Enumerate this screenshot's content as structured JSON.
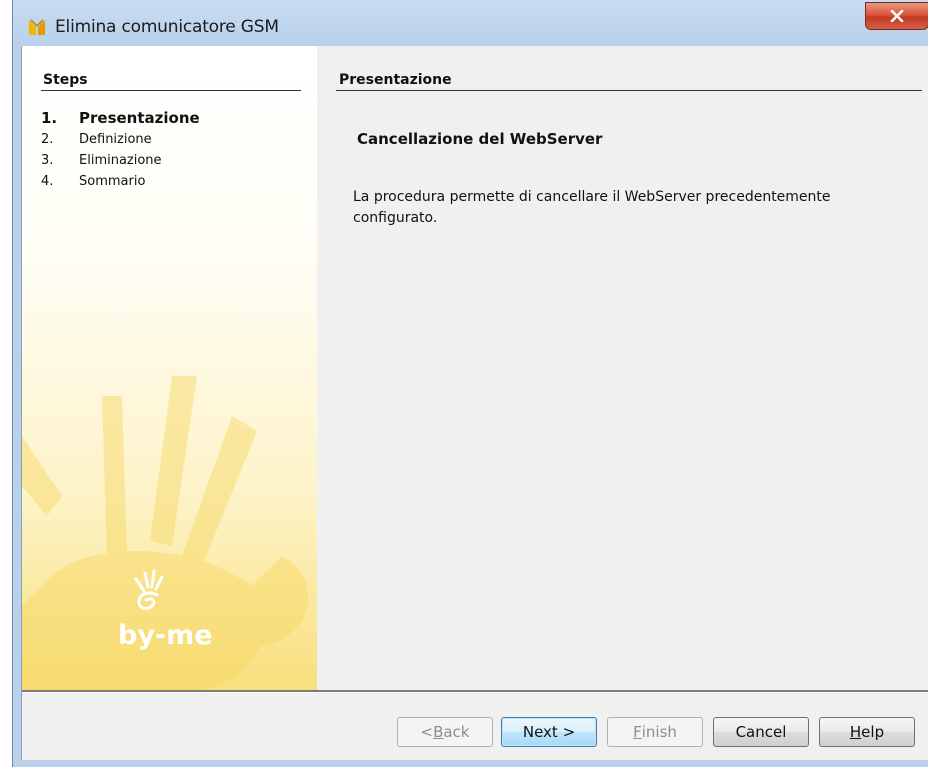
{
  "window": {
    "title": "Elimina comunicatore GSM",
    "accent": "#b9d1ec",
    "close_color": "#c23a1f"
  },
  "steps": {
    "title": "Steps",
    "items": [
      {
        "num": "1.",
        "label": "Presentazione",
        "active": true
      },
      {
        "num": "2.",
        "label": "Definizione",
        "active": false
      },
      {
        "num": "3.",
        "label": "Eliminazione",
        "active": false
      },
      {
        "num": "4.",
        "label": "Sommario",
        "active": false
      }
    ]
  },
  "branding": {
    "logo_text": "by-me",
    "logo_color": "#f2c52d"
  },
  "content": {
    "section_title": "Presentazione",
    "subtitle": "Cancellazione del WebServer",
    "body": "La procedura permette di cancellare il WebServer precedentemente configurato."
  },
  "buttons": {
    "back": {
      "prefix": "< ",
      "mnemonic": "B",
      "rest": "ack",
      "enabled": false
    },
    "next": {
      "label": "Next >",
      "enabled": true
    },
    "finish": {
      "mnemonic": "F",
      "rest": "inish",
      "enabled": false
    },
    "cancel": {
      "label": "Cancel",
      "enabled": true
    },
    "help": {
      "mnemonic": "H",
      "rest": "elp",
      "enabled": true
    }
  }
}
